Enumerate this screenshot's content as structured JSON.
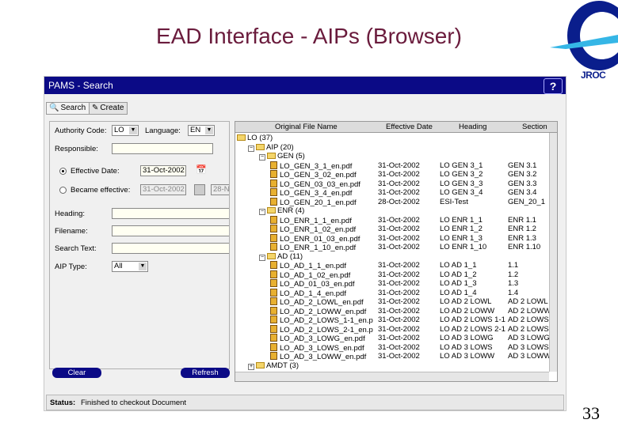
{
  "slide": {
    "title": "EAD Interface - AIPs (Browser)",
    "page_number": "33",
    "logo_text": "JROC"
  },
  "app": {
    "window_title": "PAMS - Search",
    "help_label": "?",
    "tabs": [
      {
        "label": "Search"
      },
      {
        "label": "Create"
      }
    ],
    "search_form": {
      "authority_label": "Authority Code:",
      "authority_value": "LO",
      "language_label": "Language:",
      "language_value": "EN",
      "responsible_label": "Responsible:",
      "effective_label": "Effective Date:",
      "effective_value": "31-Oct-2002",
      "became_label": "Became effective:",
      "became_from": "31-Oct-2002",
      "became_to": "28-N",
      "heading_label": "Heading:",
      "filename_label": "Filename:",
      "searchtext_label": "Search Text:",
      "aiptype_label": "AIP Type:",
      "aiptype_value": "All",
      "clear_label": "Clear",
      "refresh_label": "Refresh"
    },
    "results": {
      "columns": [
        "Original File Name",
        "Effective Date",
        "Heading",
        "Section"
      ],
      "rows": [
        {
          "kind": "folder",
          "toggle": "",
          "name": "LO (37)",
          "date": "",
          "heading": "",
          "section": ""
        },
        {
          "kind": "folder",
          "toggle": "−",
          "name": "AIP (20)",
          "date": "",
          "heading": "",
          "section": ""
        },
        {
          "kind": "folder",
          "toggle": "−",
          "name": "GEN (5)",
          "date": "",
          "heading": "",
          "section": ""
        },
        {
          "kind": "file",
          "name": "LO_GEN_3_1_en.pdf",
          "date": "31-Oct-2002",
          "heading": "LO GEN 3_1",
          "section": "GEN 3.1"
        },
        {
          "kind": "file",
          "name": "LO_GEN_3_02_en.pdf",
          "date": "31-Oct-2002",
          "heading": "LO GEN 3_2",
          "section": "GEN 3.2"
        },
        {
          "kind": "file",
          "name": "LO_GEN_03_03_en.pdf",
          "date": "31-Oct-2002",
          "heading": "LO GEN 3_3",
          "section": "GEN 3.3"
        },
        {
          "kind": "file",
          "name": "LO_GEN_3_4_en.pdf",
          "date": "31-Oct-2002",
          "heading": "LO GEN 3_4",
          "section": "GEN 3.4"
        },
        {
          "kind": "file",
          "name": "LO_GEN_20_1_en.pdf",
          "date": "28-Oct-2002",
          "heading": "ESI-Test",
          "section": "GEN_20_1"
        },
        {
          "kind": "folder",
          "toggle": "−",
          "name": "ENR (4)",
          "date": "",
          "heading": "",
          "section": ""
        },
        {
          "kind": "file",
          "name": "LO_ENR_1_1_en.pdf",
          "date": "31-Oct-2002",
          "heading": "LO ENR 1_1",
          "section": "ENR 1.1"
        },
        {
          "kind": "file",
          "name": "LO_ENR_1_02_en.pdf",
          "date": "31-Oct-2002",
          "heading": "LO ENR 1_2",
          "section": "ENR 1.2"
        },
        {
          "kind": "file",
          "name": "LO_ENR_01_03_en.pdf",
          "date": "31-Oct-2002",
          "heading": "LO ENR 1_3",
          "section": "ENR 1.3"
        },
        {
          "kind": "file",
          "name": "LO_ENR_1_10_en.pdf",
          "date": "31-Oct-2002",
          "heading": "LO ENR 1_10",
          "section": "ENR 1.10"
        },
        {
          "kind": "folder",
          "toggle": "−",
          "name": "AD (11)",
          "date": "",
          "heading": "",
          "section": ""
        },
        {
          "kind": "file",
          "name": "LO_AD_1_1_en.pdf",
          "date": "31-Oct-2002",
          "heading": "LO AD 1_1",
          "section": "1.1"
        },
        {
          "kind": "file",
          "name": "LO_AD_1_02_en.pdf",
          "date": "31-Oct-2002",
          "heading": "LO AD 1_2",
          "section": "1.2"
        },
        {
          "kind": "file",
          "name": "LO_AD_01_03_en.pdf",
          "date": "31-Oct-2002",
          "heading": "LO AD 1_3",
          "section": "1.3"
        },
        {
          "kind": "file",
          "name": "LO_AD_1_4_en.pdf",
          "date": "31-Oct-2002",
          "heading": "LO AD 1_4",
          "section": "1.4"
        },
        {
          "kind": "file",
          "name": "LO_AD_2_LOWL_en.pdf",
          "date": "31-Oct-2002",
          "heading": "LO AD 2 LOWL",
          "section": "AD 2 LOWL"
        },
        {
          "kind": "file",
          "name": "LO_AD_2_LOWW_en.pdf",
          "date": "31-Oct-2002",
          "heading": "LO AD 2 LOWW",
          "section": "AD 2 LOWW"
        },
        {
          "kind": "file",
          "name": "LO_AD_2_LOWS_1-1_en.p",
          "date": "31-Oct-2002",
          "heading": "LO AD 2 LOWS 1-1",
          "section": "AD 2 LOWS"
        },
        {
          "kind": "file",
          "name": "LO_AD_2_LOWS_2-1_en.p",
          "date": "31-Oct-2002",
          "heading": "LO AD 2 LOWS 2-1",
          "section": "AD 2 LOWS"
        },
        {
          "kind": "file",
          "name": "LO_AD_3_LOWG_en.pdf",
          "date": "31-Oct-2002",
          "heading": "LO AD 3 LOWG",
          "section": "AD 3 LOWG"
        },
        {
          "kind": "file",
          "name": "LO_AD_3_LOWS_en.pdf",
          "date": "31-Oct-2002",
          "heading": "LO AD 3 LOWS",
          "section": "AD 3 LOWS"
        },
        {
          "kind": "file",
          "name": "LO_AD_3_LOWW_en.pdf",
          "date": "31-Oct-2002",
          "heading": "LO AD 3 LOWW",
          "section": "AD 3 LOWW"
        },
        {
          "kind": "folder",
          "toggle": "+",
          "name": "AMDT (3)",
          "date": "",
          "heading": "",
          "section": ""
        }
      ]
    },
    "status": {
      "label": "Status:",
      "text": "Finished to checkout Document"
    }
  }
}
